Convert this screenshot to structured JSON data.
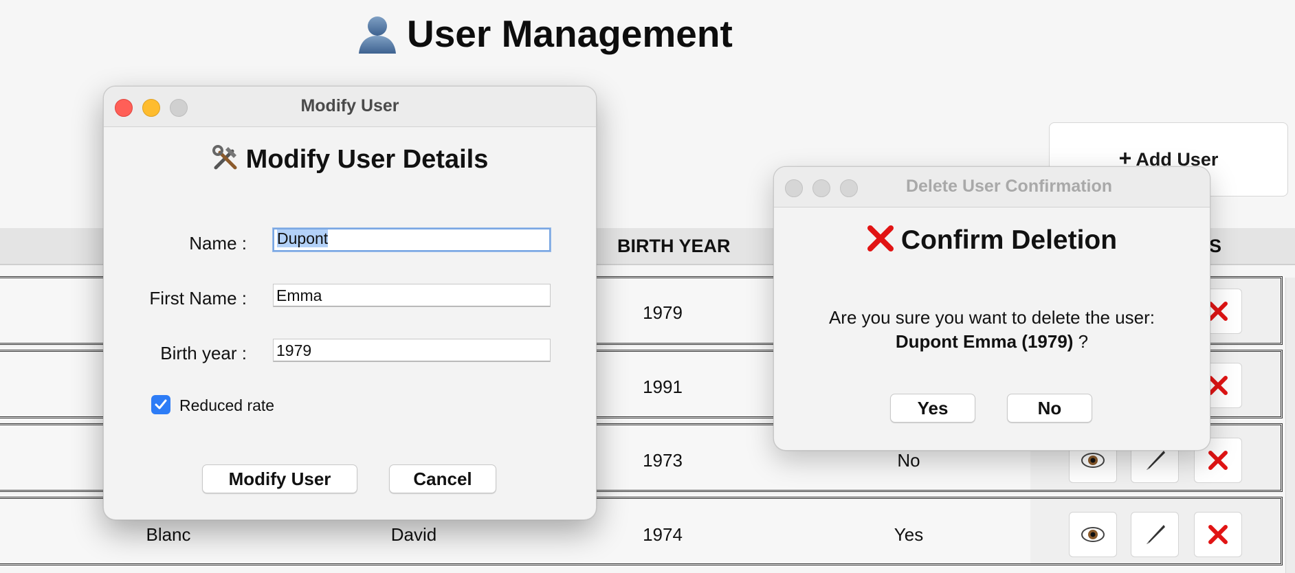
{
  "page": {
    "title": "User Management",
    "add_user_label": "Add User"
  },
  "table": {
    "columns": [
      "BIRTH YEAR",
      "S"
    ],
    "rows": [
      {
        "name": "",
        "first_name": "",
        "birth_year": "1979",
        "reduced": ""
      },
      {
        "name": "",
        "first_name": "",
        "birth_year": "1991",
        "reduced": ""
      },
      {
        "name": "",
        "first_name": "",
        "birth_year": "1973",
        "reduced": "No"
      },
      {
        "name": "Blanc",
        "first_name": "David",
        "birth_year": "1974",
        "reduced": "Yes"
      }
    ]
  },
  "modify_dialog": {
    "window_title": "Modify User",
    "heading": "Modify User Details",
    "name_label": "Name :",
    "name_value": "Dupont",
    "first_name_label": "First Name :",
    "first_name_value": "Emma",
    "birth_year_label": "Birth year :",
    "birth_year_value": "1979",
    "reduced_rate_label": "Reduced rate",
    "reduced_rate_checked": true,
    "modify_button": "Modify User",
    "cancel_button": "Cancel"
  },
  "delete_dialog": {
    "window_title": "Delete User Confirmation",
    "heading": "Confirm Deletion",
    "question": "Are you sure you want to delete the user:",
    "user_display": "Dupont Emma (1979)",
    "question_mark": " ?",
    "yes_button": "Yes",
    "no_button": "No"
  },
  "colors": {
    "close": "#ff5f57",
    "minimize": "#febc2e",
    "zoom_inactive": "#d0d0d0",
    "delete_red": "#e11414",
    "checkbox_blue": "#2d7cf6"
  },
  "icons": {
    "title": "user-silhouette-icon",
    "add": "plus-icon",
    "view": "eye-icon",
    "edit": "pen-icon",
    "delete": "red-x-icon",
    "tools": "hammer-wrench-icon"
  }
}
